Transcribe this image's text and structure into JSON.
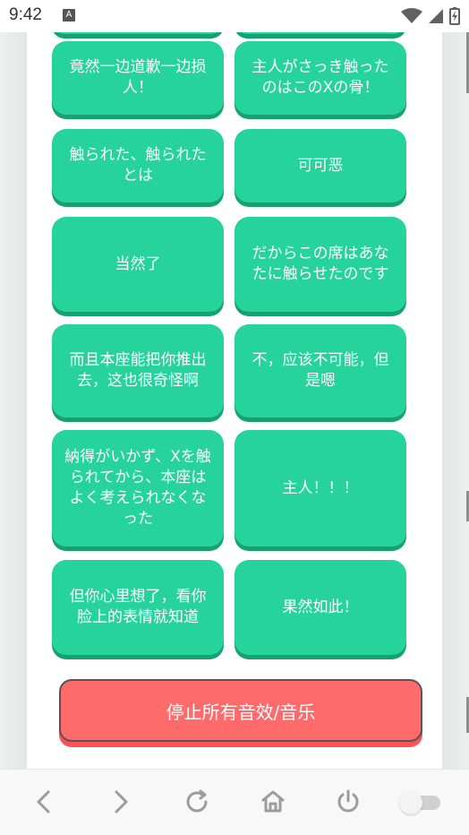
{
  "status": {
    "time": "9:42",
    "a_badge": "A",
    "icons": [
      "wifi-icon",
      "signal-icon",
      "battery-icon"
    ]
  },
  "buttons": [
    {
      "label": "竟然一边道歉一边损人！"
    },
    {
      "label": "主人がさっき触ったのはこのXの骨！"
    },
    {
      "label": "触られた、触られたとは"
    },
    {
      "label": "可可恶"
    },
    {
      "label": "当然了"
    },
    {
      "label": "だからこの席はあなたに触らせたのです"
    },
    {
      "label": "而且本座能把你推出去，这也很奇怪啊"
    },
    {
      "label": "不，应该不可能，但是嗯"
    },
    {
      "label": "納得がいかず、Xを触られてから、本座はよく考えられなくなった"
    },
    {
      "label": "主人！！！"
    },
    {
      "label": "但你心里想了，看你脸上的表情就知道"
    },
    {
      "label": "果然如此！"
    }
  ],
  "stop": {
    "label": "停止所有音效/音乐"
  },
  "navigation": {
    "items": [
      "back-icon",
      "forward-icon",
      "reload-icon",
      "home-icon",
      "power-icon",
      "toggle-switch"
    ]
  },
  "colors": {
    "button_green": "#26d39b",
    "button_shadow": "#17a16f",
    "stop_red": "#ff6b6b"
  }
}
